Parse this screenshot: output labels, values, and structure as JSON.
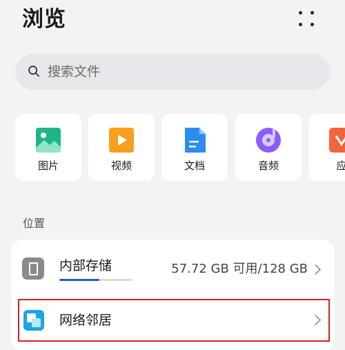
{
  "header": {
    "title": "浏览",
    "more_icon": "more-dots-icon"
  },
  "search": {
    "placeholder": "搜索文件",
    "icon": "search-icon"
  },
  "categories": [
    {
      "label": "图片",
      "icon": "picture-icon",
      "color": "#1fb58a"
    },
    {
      "label": "视频",
      "icon": "video-icon",
      "color": "#f7a01e"
    },
    {
      "label": "文档",
      "icon": "document-icon",
      "color": "#2d8cf0"
    },
    {
      "label": "音频",
      "icon": "audio-icon",
      "color": "#8b5cf6"
    },
    {
      "label": "应",
      "icon": "app-icon",
      "color": "#f2643c"
    }
  ],
  "locations": {
    "section_label": "位置",
    "internal_storage": {
      "name": "内部存储",
      "usage": "57.72 GB 可用/128 GB",
      "used_fraction": 0.55,
      "accent": "#1f5fc8"
    },
    "network": {
      "name": "网络邻居",
      "highlight_color": "#d4201f"
    }
  }
}
